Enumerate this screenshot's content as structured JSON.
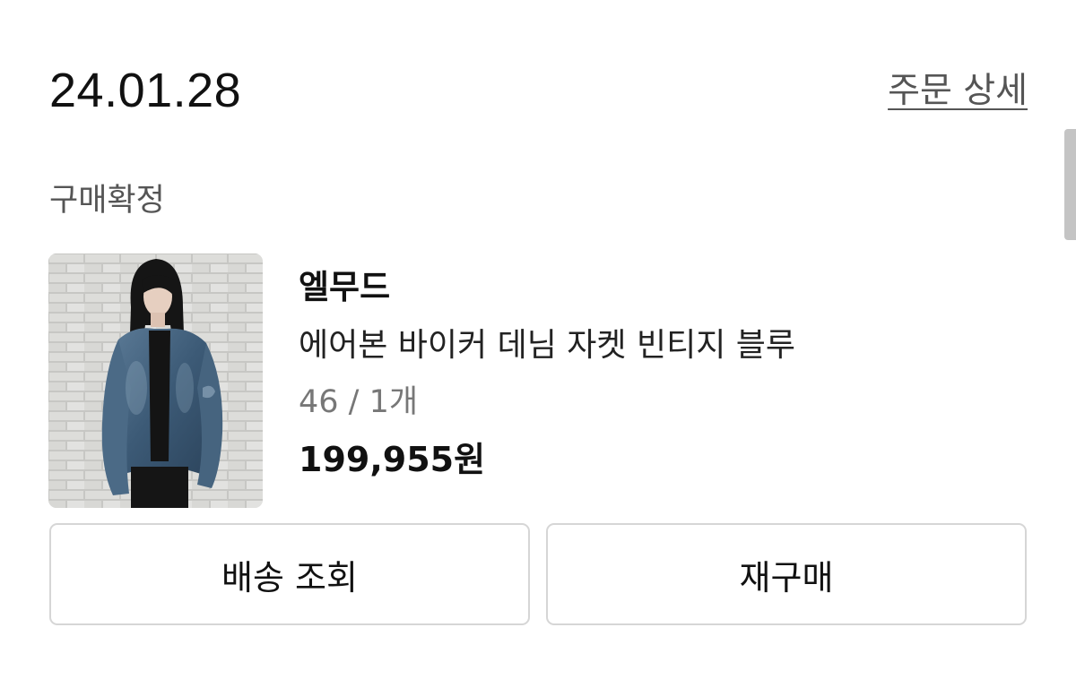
{
  "order": {
    "date": "24.01.28",
    "detail_link": "주문 상세",
    "status": "구매확정"
  },
  "product": {
    "brand": "엘무드",
    "name": "에어본 바이커 데님 자켓 빈티지 블루",
    "option": "46 / 1개",
    "price": "199,955원",
    "colors": {
      "denim": "#3f5f7c",
      "wall": "#c8c8c4"
    }
  },
  "actions": {
    "tracking_label": "배송 조회",
    "rebuy_label": "재구매"
  }
}
